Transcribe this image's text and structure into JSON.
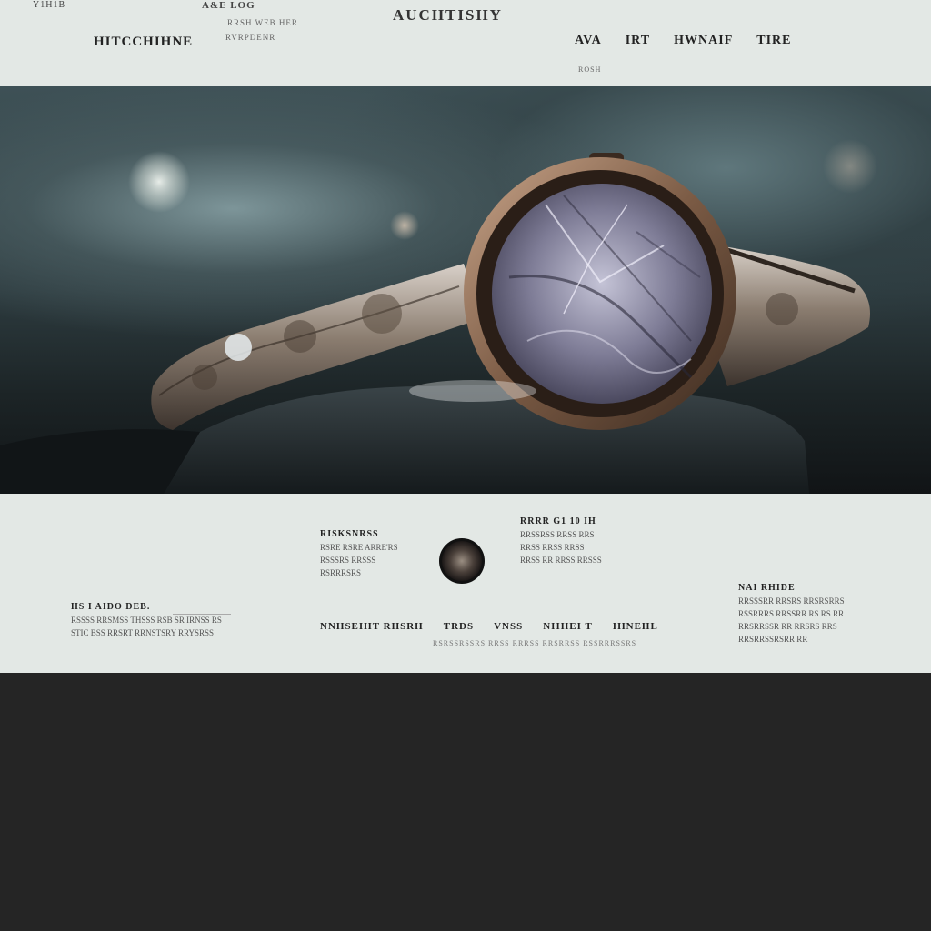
{
  "header": {
    "top_left": "Y1H1B",
    "top_mid": "A&E LOG",
    "top_mid_line1": "RRSH WEB HER",
    "top_mid_line2": "RVRPDENR",
    "site_title": "AUCHTISHY",
    "logo": "HITCCHIHNE",
    "nav": [
      "AVA",
      "IRT",
      "HWNAIF",
      "TIRE"
    ],
    "nav_sub": "ROSH"
  },
  "hero": {
    "product_alt": "watch-photo"
  },
  "info": {
    "left": {
      "heading": "HS I AIDO DEB.",
      "lines": [
        "RSSSS RRSMSS THSSS RSB SR IRNSS RS",
        "STIC BSS RRSRT RRNSTSRY RRYSRSS"
      ]
    },
    "mid1": {
      "heading": "RISKSNRSS",
      "sub": "RSRE RSRE ARRE'RS",
      "lines": [
        "RSSSRS RRSSS",
        "RSRRRSRS"
      ]
    },
    "mid2": {
      "heading": "RRRR G1 10 IH",
      "lines": [
        "RRSSRSS RRSS RRS",
        "RRSS RRSS RRSS",
        "RRSS RR RRSS RRSSS"
      ]
    },
    "right": {
      "heading": "NAI RHIDE",
      "lines": [
        "RRSSSRR RRSRS RRSRSRRS",
        "RSSRRRS RRSSRR RS RS RR",
        "RRSRRSSR RR RRSRS RRS",
        "RRSRRSSRSRR RR"
      ]
    },
    "links": [
      "NNHSEIHT RHSRH",
      "TRDS",
      "VNSS",
      "NIIHEI T",
      "IHNEHL"
    ],
    "foot_note": "RSRSSRSSRS RRSS RRRSS RRSRRSS RSSRRRSSRS"
  },
  "colors": {
    "panel": "#e3e8e5",
    "dark_bg": "#252525",
    "bezel": "#7a5a44"
  }
}
